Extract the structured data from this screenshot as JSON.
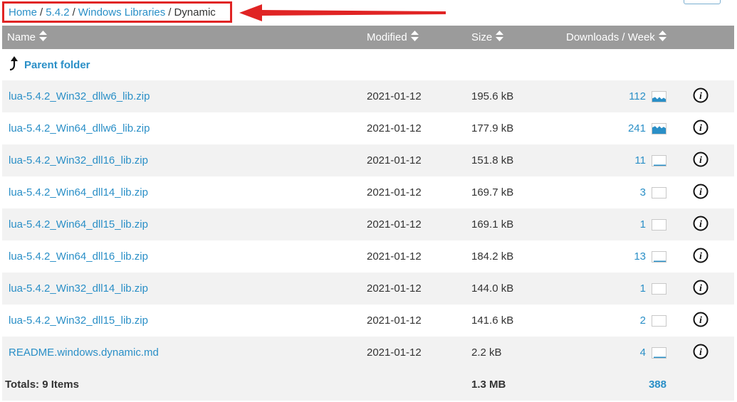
{
  "breadcrumb": {
    "items": [
      {
        "label": "Home",
        "link": true
      },
      {
        "label": "5.4.2",
        "link": true
      },
      {
        "label": "Windows Libraries",
        "link": true
      },
      {
        "label": "Dynamic",
        "link": false
      }
    ],
    "separator": "/"
  },
  "table": {
    "headers": {
      "name": "Name",
      "modified": "Modified",
      "size": "Size",
      "downloads": "Downloads / Week"
    },
    "parent_label": "Parent folder",
    "rows": [
      {
        "name": "lua-5.4.2_Win32_dllw6_lib.zip",
        "modified": "2021-01-12",
        "size": "195.6 kB",
        "downloads": "112",
        "spark_level": 0.55
      },
      {
        "name": "lua-5.4.2_Win64_dllw6_lib.zip",
        "modified": "2021-01-12",
        "size": "177.9 kB",
        "downloads": "241",
        "spark_level": 0.9
      },
      {
        "name": "lua-5.4.2_Win32_dll16_lib.zip",
        "modified": "2021-01-12",
        "size": "151.8 kB",
        "downloads": "11",
        "spark_level": 0.1
      },
      {
        "name": "lua-5.4.2_Win64_dll14_lib.zip",
        "modified": "2021-01-12",
        "size": "169.7 kB",
        "downloads": "3",
        "spark_level": 0.0
      },
      {
        "name": "lua-5.4.2_Win64_dll15_lib.zip",
        "modified": "2021-01-12",
        "size": "169.1 kB",
        "downloads": "1",
        "spark_level": 0.0
      },
      {
        "name": "lua-5.4.2_Win64_dll16_lib.zip",
        "modified": "2021-01-12",
        "size": "184.2 kB",
        "downloads": "13",
        "spark_level": 0.1
      },
      {
        "name": "lua-5.4.2_Win32_dll14_lib.zip",
        "modified": "2021-01-12",
        "size": "144.0 kB",
        "downloads": "1",
        "spark_level": 0.0
      },
      {
        "name": "lua-5.4.2_Win32_dll15_lib.zip",
        "modified": "2021-01-12",
        "size": "141.6 kB",
        "downloads": "2",
        "spark_level": 0.0
      },
      {
        "name": "README.windows.dynamic.md",
        "modified": "2021-01-12",
        "size": "2.2 kB",
        "downloads": "4",
        "spark_level": 0.05
      }
    ],
    "totals": {
      "label": "Totals: 9 Items",
      "size": "1.3 MB",
      "downloads": "388"
    }
  },
  "colors": {
    "link": "#2a8fc7",
    "header_bg": "#9b9b9b",
    "annotation": "#e02424",
    "row_alt": "#f2f2f2"
  },
  "icons": {
    "sort": "sort-icon",
    "parent": "up-arrow-icon",
    "info": "info-icon",
    "sparkline": "sparkline-icon"
  }
}
